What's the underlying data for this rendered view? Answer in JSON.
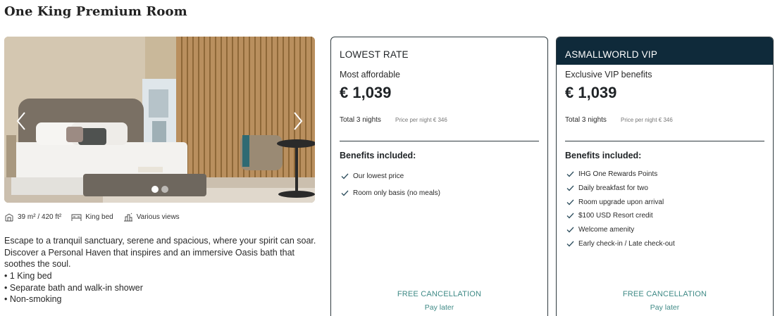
{
  "room": {
    "title": "One King Premium Room",
    "features": [
      {
        "icon": "room-size-icon",
        "label": "39 m² / 420 ft²"
      },
      {
        "icon": "bed-icon",
        "label": "King bed"
      },
      {
        "icon": "city-view-icon",
        "label": "Various views"
      }
    ],
    "description": "Escape to a tranquil sanctuary, serene and spacious, where your spirit can soar. Discover a Personal Haven that inspires and an immersive Oasis bath that soothes the soul.",
    "bullets": [
      "1 King bed",
      "Separate bath and walk-in shower",
      "Non-smoking"
    ],
    "gallery": {
      "current": 1,
      "total": 2,
      "prev_icon": "chevron-left-icon",
      "next_icon": "chevron-right-icon"
    }
  },
  "rates": [
    {
      "header": "LOWEST RATE",
      "subtitle": "Most affordable",
      "price": "€ 1,039",
      "total": "Total 3 nights",
      "per_night": "Price per night € 346",
      "benefits_heading": "Benefits included:",
      "benefits": [
        "Our lowest price",
        "Room only basis (no meals)"
      ],
      "cancellation": "FREE CANCELLATION",
      "payment": "Pay later"
    },
    {
      "header": "ASMALLWORLD VIP",
      "subtitle": "Exclusive VIP benefits",
      "price": "€ 1,039",
      "total": "Total 3 nights",
      "per_night": "Price per night € 346",
      "benefits_heading": "Benefits included:",
      "benefits": [
        "IHG One Rewards Points",
        "Daily breakfast for two",
        "Room upgrade upon arrival",
        "$100 USD Resort credit",
        "Welcome amenity",
        "Early check-in / Late check-out"
      ],
      "cancellation": "FREE CANCELLATION",
      "payment": "Pay later"
    }
  ],
  "colors": {
    "vip_header": "#0f2a3a",
    "accent_teal": "#3f8a86",
    "check": "#2f4f5f"
  }
}
